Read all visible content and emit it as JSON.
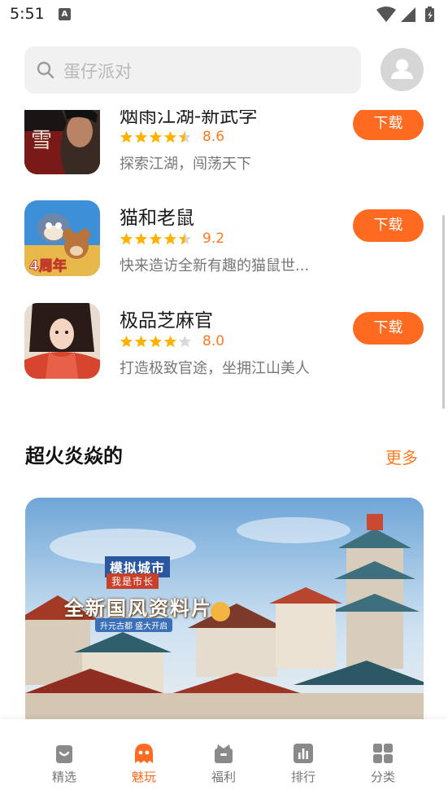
{
  "status_bar": {
    "time": "5:51",
    "a_icon": "A"
  },
  "search": {
    "placeholder": "蛋仔派对"
  },
  "games": [
    {
      "name": "烟雨江湖-新武学",
      "rating": "8.6",
      "stars": 4.5,
      "desc": "探索江湖，闯荡天下",
      "button": "下载",
      "icon": "martial-arts-game-icon"
    },
    {
      "name": "猫和老鼠",
      "rating": "9.2",
      "stars": 4.5,
      "desc": "快来造访全新有趣的猫鼠世...",
      "button": "下载",
      "icon": "tom-and-jerry-game-icon"
    },
    {
      "name": "极品芝麻官",
      "rating": "8.0",
      "stars": 4,
      "desc": "打造极致官途，坐拥江山美人",
      "button": "下载",
      "icon": "official-game-icon"
    }
  ],
  "section": {
    "title": "超火炎焱的",
    "more": "更多"
  },
  "banner": {
    "title": "模拟城市",
    "subtitle": "我是市长",
    "slogan": "全新国风资料片",
    "tag": "升元古都 盛大开启"
  },
  "nav": [
    {
      "label": "精选",
      "icon": "bag-icon",
      "active": false
    },
    {
      "label": "魅玩",
      "icon": "ghost-icon",
      "active": true
    },
    {
      "label": "福利",
      "icon": "gift-icon",
      "active": false
    },
    {
      "label": "排行",
      "icon": "chart-icon",
      "active": false
    },
    {
      "label": "分类",
      "icon": "grid-icon",
      "active": false
    }
  ],
  "colors": {
    "accent": "#ff6a21",
    "rating": "#ff7a22",
    "star": "#ffb300",
    "star_empty": "#d8d8d8"
  }
}
